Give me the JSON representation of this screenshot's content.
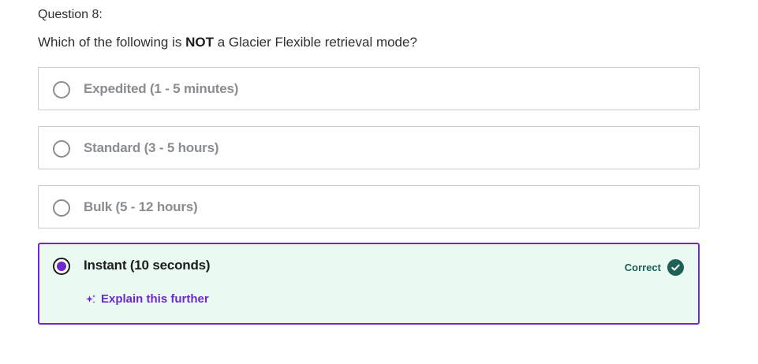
{
  "question": {
    "number_label": "Question 8:",
    "text_before": "Which of the following is ",
    "text_emphasis": "NOT",
    "text_after": " a Glacier Flexible retrieval mode?"
  },
  "options": [
    {
      "label": "Expedited (1 - 5 minutes)",
      "selected": false
    },
    {
      "label": "Standard (3 - 5 hours)",
      "selected": false
    },
    {
      "label": "Bulk (5 - 12 hours)",
      "selected": false
    },
    {
      "label": "Instant (10 seconds)",
      "selected": true,
      "status": "Correct",
      "status_icon": "check-circle-icon",
      "explain_label": "Explain this further",
      "explain_icon": "sparkle-icon"
    }
  ],
  "colors": {
    "accent_purple": "#6d28d2",
    "correct_green": "#1e6055",
    "correct_bg": "#eafaf1",
    "muted_text": "#8a8d90"
  }
}
